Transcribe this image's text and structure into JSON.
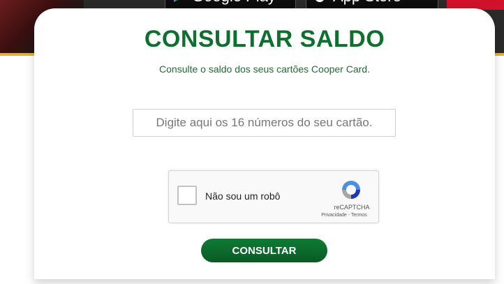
{
  "banner": {
    "google_play_label": "Google Play",
    "app_store_label": "App Store"
  },
  "card": {
    "title": "CONSULTAR SALDO",
    "subtitle": "Consulte o saldo dos seus cartões Cooper Card.",
    "card_number_placeholder": "Digite aqui os 16 números do seu cartão.",
    "card_number_value": "",
    "captcha": {
      "label": "Não sou um robô",
      "brand": "reCAPTCHA",
      "links": "Privacidade - Termos",
      "icon": "recaptcha-icon"
    },
    "submit_label": "CONSULTAR"
  },
  "colors": {
    "primary_green": "#0e6f2e",
    "gold_accent": "#e2b13c",
    "red_accent": "#d0112b"
  }
}
